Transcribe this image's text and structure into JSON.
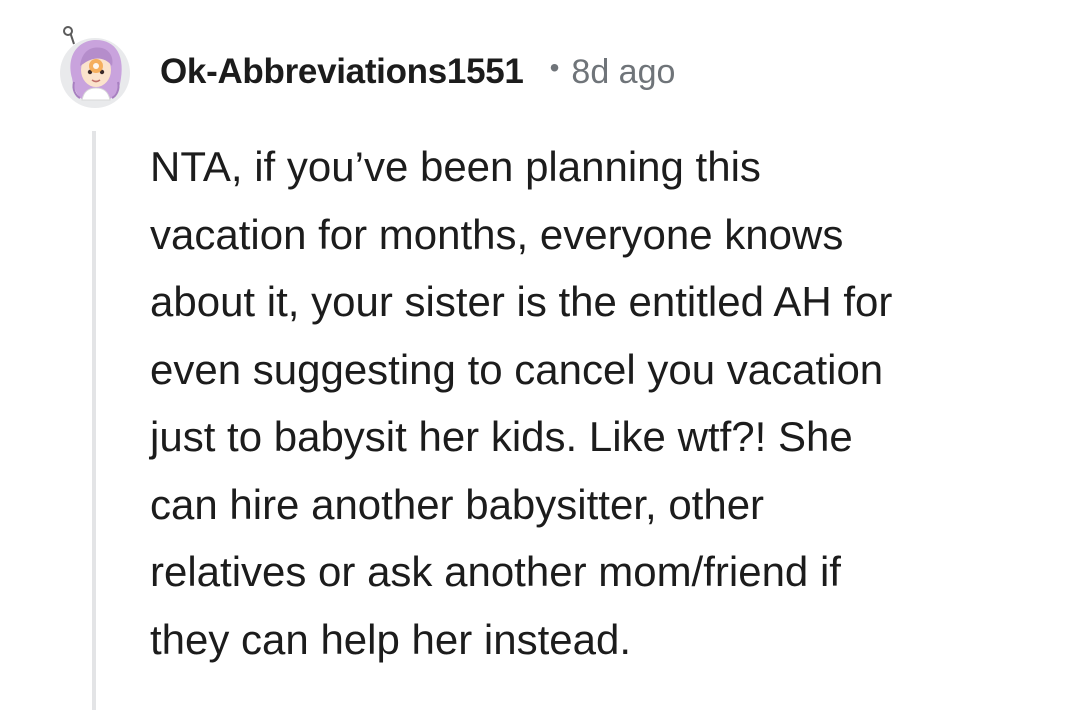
{
  "comment": {
    "username": "Ok-Abbreviations1551",
    "separator": "•",
    "timestamp": "8d ago",
    "avatar_icon": "reddit-avatar-icon",
    "body_lines": [
      "NTA, if you’ve been planning this",
      "vacation for months, everyone knows",
      "about it, your sister is the entitled AH for",
      "even suggesting to cancel you vacation",
      "just to babysit her kids. Like wtf?! She",
      "can hire another babysitter, other",
      "relatives or ask another mom/friend if",
      "they can help her instead."
    ]
  },
  "colors": {
    "text": "#1c1c1c",
    "meta": "#6f7479",
    "thread_line": "#e3e4e6",
    "avatar_bg": "#e9eaec",
    "avatar_hair": "#c9a3dd"
  }
}
